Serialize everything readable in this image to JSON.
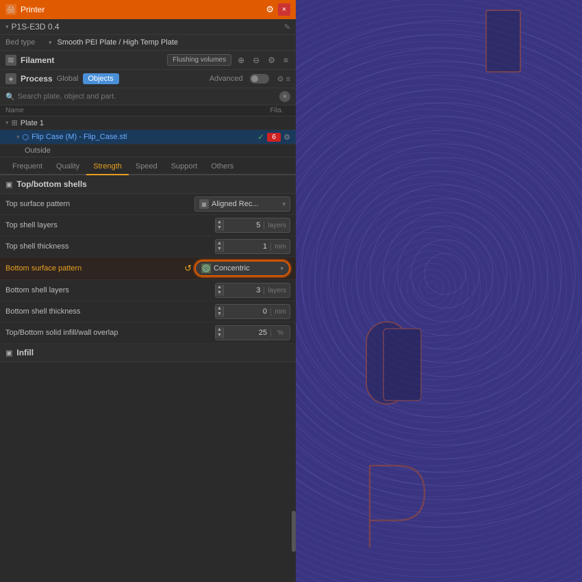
{
  "titleBar": {
    "title": "Printer",
    "closeLabel": "×",
    "settingsIcon": "⚙"
  },
  "printer": {
    "name": "P1S-E3D 0.4",
    "editIcon": "✎",
    "bedTypeLabel": "Bed type",
    "bedTypeValue": "Smooth PEI Plate / High Temp Plate",
    "dropdownArrow": "▾"
  },
  "filament": {
    "label": "Filament",
    "flushVolumesBtn": "Flushing volumes",
    "icons": [
      "⚙",
      "⚙",
      "⚙",
      "⚙"
    ]
  },
  "process": {
    "label": "Process",
    "globalBtn": "Global",
    "objectsBtn": "Objects",
    "advancedLabel": "Advanced"
  },
  "search": {
    "placeholder": "Search plate, object and part.",
    "clearIcon": "×"
  },
  "objectTree": {
    "columns": {
      "name": "Name",
      "fila": "Fila."
    },
    "plate": "Plate 1",
    "object": "Flip Case (M) - Flip_Case.stl",
    "subItem": "Outside",
    "filaNumber": "6",
    "checkIcon": "✓"
  },
  "tabs": [
    {
      "id": "frequent",
      "label": "Frequent"
    },
    {
      "id": "quality",
      "label": "Quality"
    },
    {
      "id": "strength",
      "label": "Strength",
      "active": true
    },
    {
      "id": "speed",
      "label": "Speed"
    },
    {
      "id": "support",
      "label": "Support"
    },
    {
      "id": "others",
      "label": "Others"
    }
  ],
  "settings": {
    "groupTitle": "Top/bottom shells",
    "rows": [
      {
        "id": "top-surface-pattern",
        "name": "Top surface pattern",
        "value": "Aligned Rec...",
        "type": "pattern",
        "icon": "▦"
      },
      {
        "id": "top-shell-layers",
        "name": "Top shell layers",
        "value": "5",
        "unit": "layers",
        "type": "number"
      },
      {
        "id": "top-shell-thickness",
        "name": "Top shell thickness",
        "value": "1",
        "unit": "mm",
        "type": "number"
      },
      {
        "id": "bottom-surface-pattern",
        "name": "Bottom surface pattern",
        "value": "Concentric",
        "type": "concentric",
        "highlighted": true,
        "icon": "◎"
      },
      {
        "id": "bottom-shell-layers",
        "name": "Bottom shell layers",
        "value": "3",
        "unit": "layers",
        "type": "number"
      },
      {
        "id": "bottom-shell-thickness",
        "name": "Bottom shell thickness",
        "value": "0",
        "unit": "mm",
        "type": "number"
      },
      {
        "id": "topbottom-solid-infill",
        "name": "Top/Bottom solid infill/wall overlap",
        "value": "25",
        "unit": "%",
        "type": "number"
      }
    ],
    "infillGroupTitle": "Infill"
  },
  "scrollbar": {
    "visible": true
  },
  "icons": {
    "printer": "🖨",
    "layer": "≡",
    "process": "◈",
    "search": "🔍",
    "plate": "⊞",
    "object": "⬡",
    "group": "▣"
  }
}
